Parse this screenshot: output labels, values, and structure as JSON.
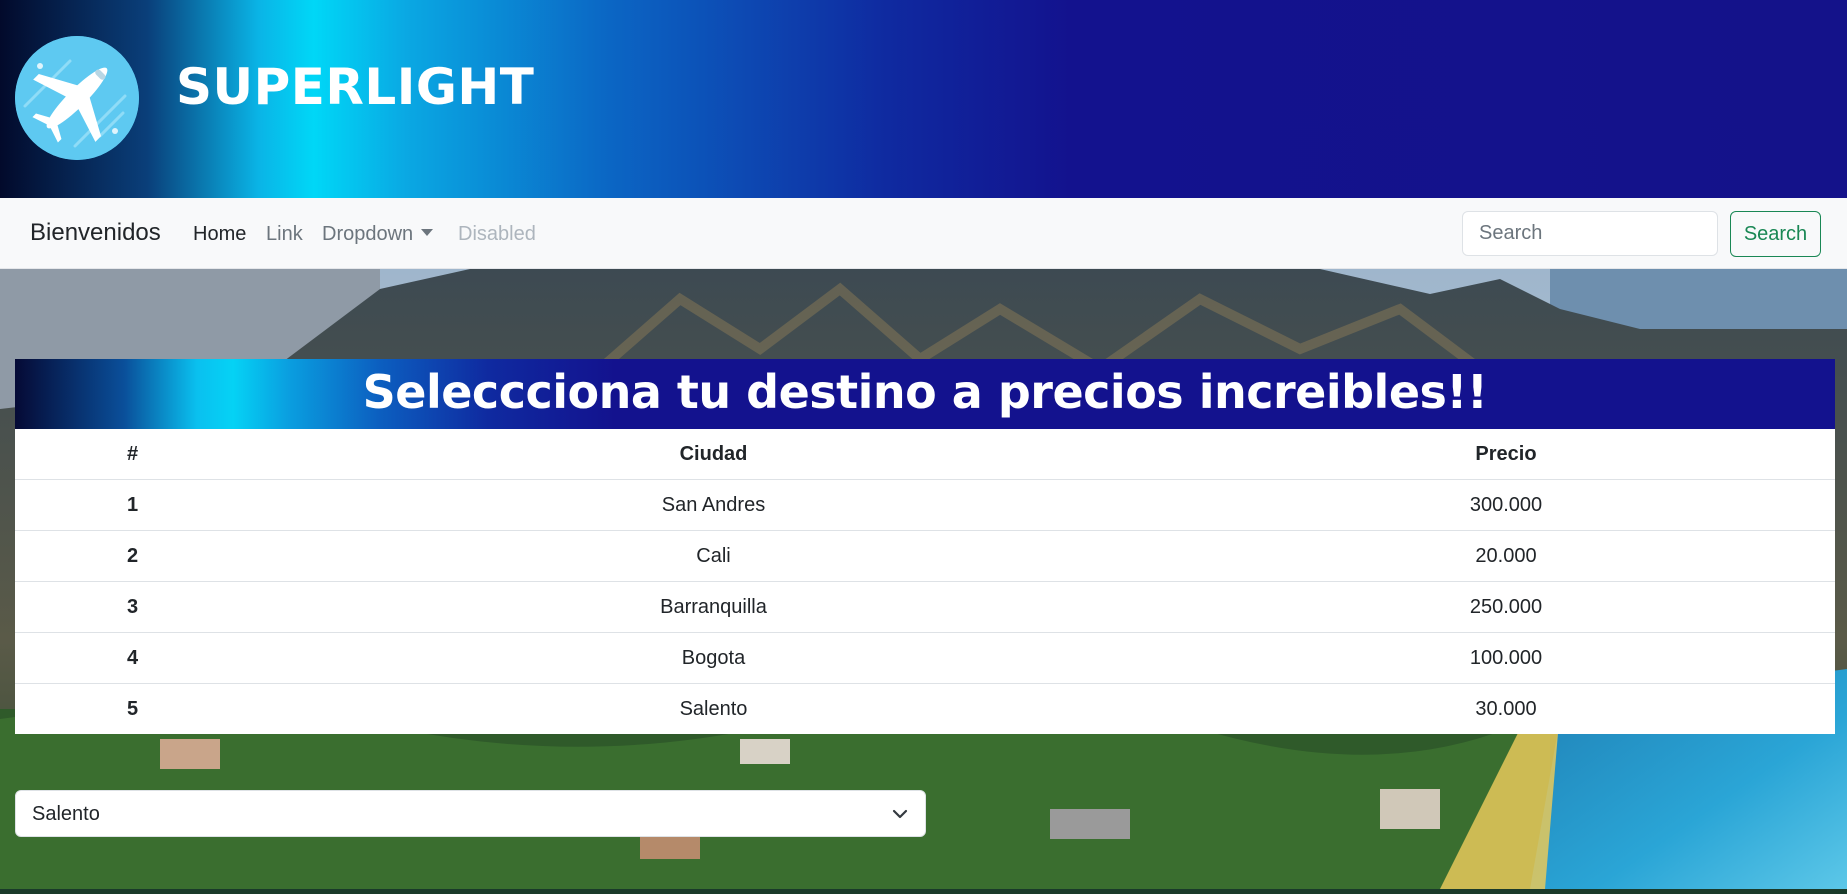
{
  "header": {
    "brand": "SUPERLIGHT",
    "logo_icon": "airplane-icon"
  },
  "navbar": {
    "brand": "Bienvenidos",
    "links": [
      {
        "label": "Home",
        "state": "active"
      },
      {
        "label": "Link",
        "state": "normal"
      },
      {
        "label": "Dropdown",
        "state": "dropdown"
      },
      {
        "label": "Disabled",
        "state": "disabled"
      }
    ],
    "search_placeholder": "Search",
    "search_button": "Search"
  },
  "main": {
    "title": "Seleccciona tu destino a precios increibles!!",
    "table": {
      "headers": [
        "#",
        "Ciudad",
        "Precio"
      ],
      "rows": [
        {
          "num": "1",
          "city": "San Andres",
          "price": "300.000"
        },
        {
          "num": "2",
          "city": "Cali",
          "price": "20.000"
        },
        {
          "num": "3",
          "city": "Barranquilla",
          "price": "250.000"
        },
        {
          "num": "4",
          "city": "Bogota",
          "price": "100.000"
        },
        {
          "num": "5",
          "city": "Salento",
          "price": "30.000"
        }
      ]
    },
    "select": {
      "value": "Salento",
      "icon": "chevron-down-icon"
    }
  },
  "colors": {
    "banner_dark": "#13128e",
    "banner_cyan": "#00d7f7",
    "search_green": "#198754",
    "navbar_bg": "#f8f9fa"
  }
}
